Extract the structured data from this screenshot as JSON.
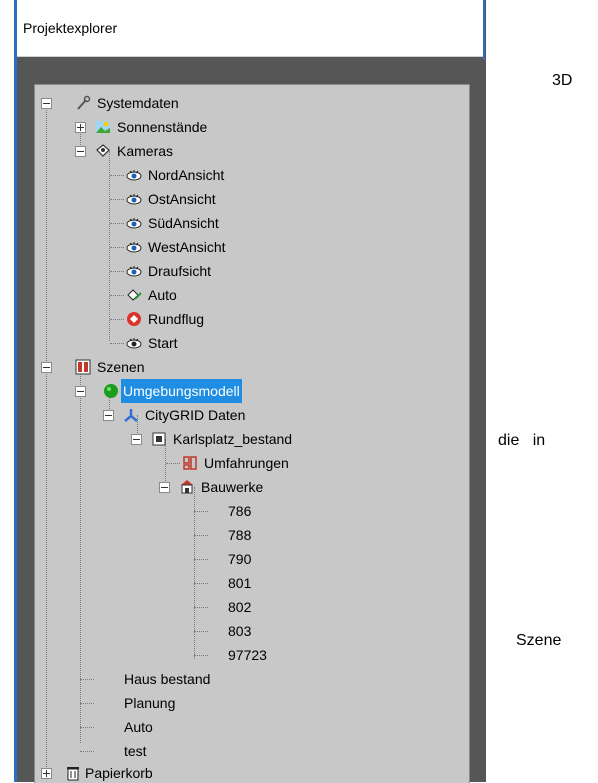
{
  "panel": {
    "title": "Projektexplorer"
  },
  "tree": {
    "systemdaten": "Systemdaten",
    "sonnenstaende": "Sonnenstände",
    "kameras": "Kameras",
    "cams": [
      "NordAnsicht",
      "OstAnsicht",
      "SüdAnsicht",
      "WestAnsicht",
      "Draufsicht"
    ],
    "auto_cam": "Auto",
    "rundflug": "Rundflug",
    "start": "Start",
    "szenen": "Szenen",
    "umgebungsmodell": "Umgebungsmodell",
    "citygrid": "CityGRID Daten",
    "karlsplatz": "Karlsplatz_bestand",
    "umfahrungen": "Umfahrungen",
    "bauwerke": "Bauwerke",
    "bauwerk_items": [
      "786",
      "788",
      "790",
      "801",
      "802",
      "803",
      "97723"
    ],
    "szenen_items": [
      "Haus bestand",
      "Planung",
      "Auto",
      "test"
    ],
    "papierkorb": "Papierkorb"
  },
  "side_text": [
    "3D",
    "die   in",
    "Szene"
  ],
  "colors": {
    "accent": "#2b6fc2",
    "selection": "#1e8de2",
    "tree_bg": "#c8c8c8",
    "panel_bg": "#565656"
  },
  "icons": {
    "systemdaten": "wrench-icon",
    "sonnenstaende": "landscape-icon",
    "kameras": "camera-folder-icon",
    "view": "eye-camera-icon",
    "auto_cam": "path-camera-icon",
    "rundflug": "flight-camera-icon",
    "start": "start-camera-icon",
    "szenen": "scene-icon",
    "umgebungsmodell": "green-sphere-icon",
    "citygrid": "citygrid-icon",
    "karlsplatz": "model-icon",
    "umfahrungen": "outline-icon",
    "bauwerke": "buildings-icon",
    "papierkorb": "trash-icon"
  }
}
